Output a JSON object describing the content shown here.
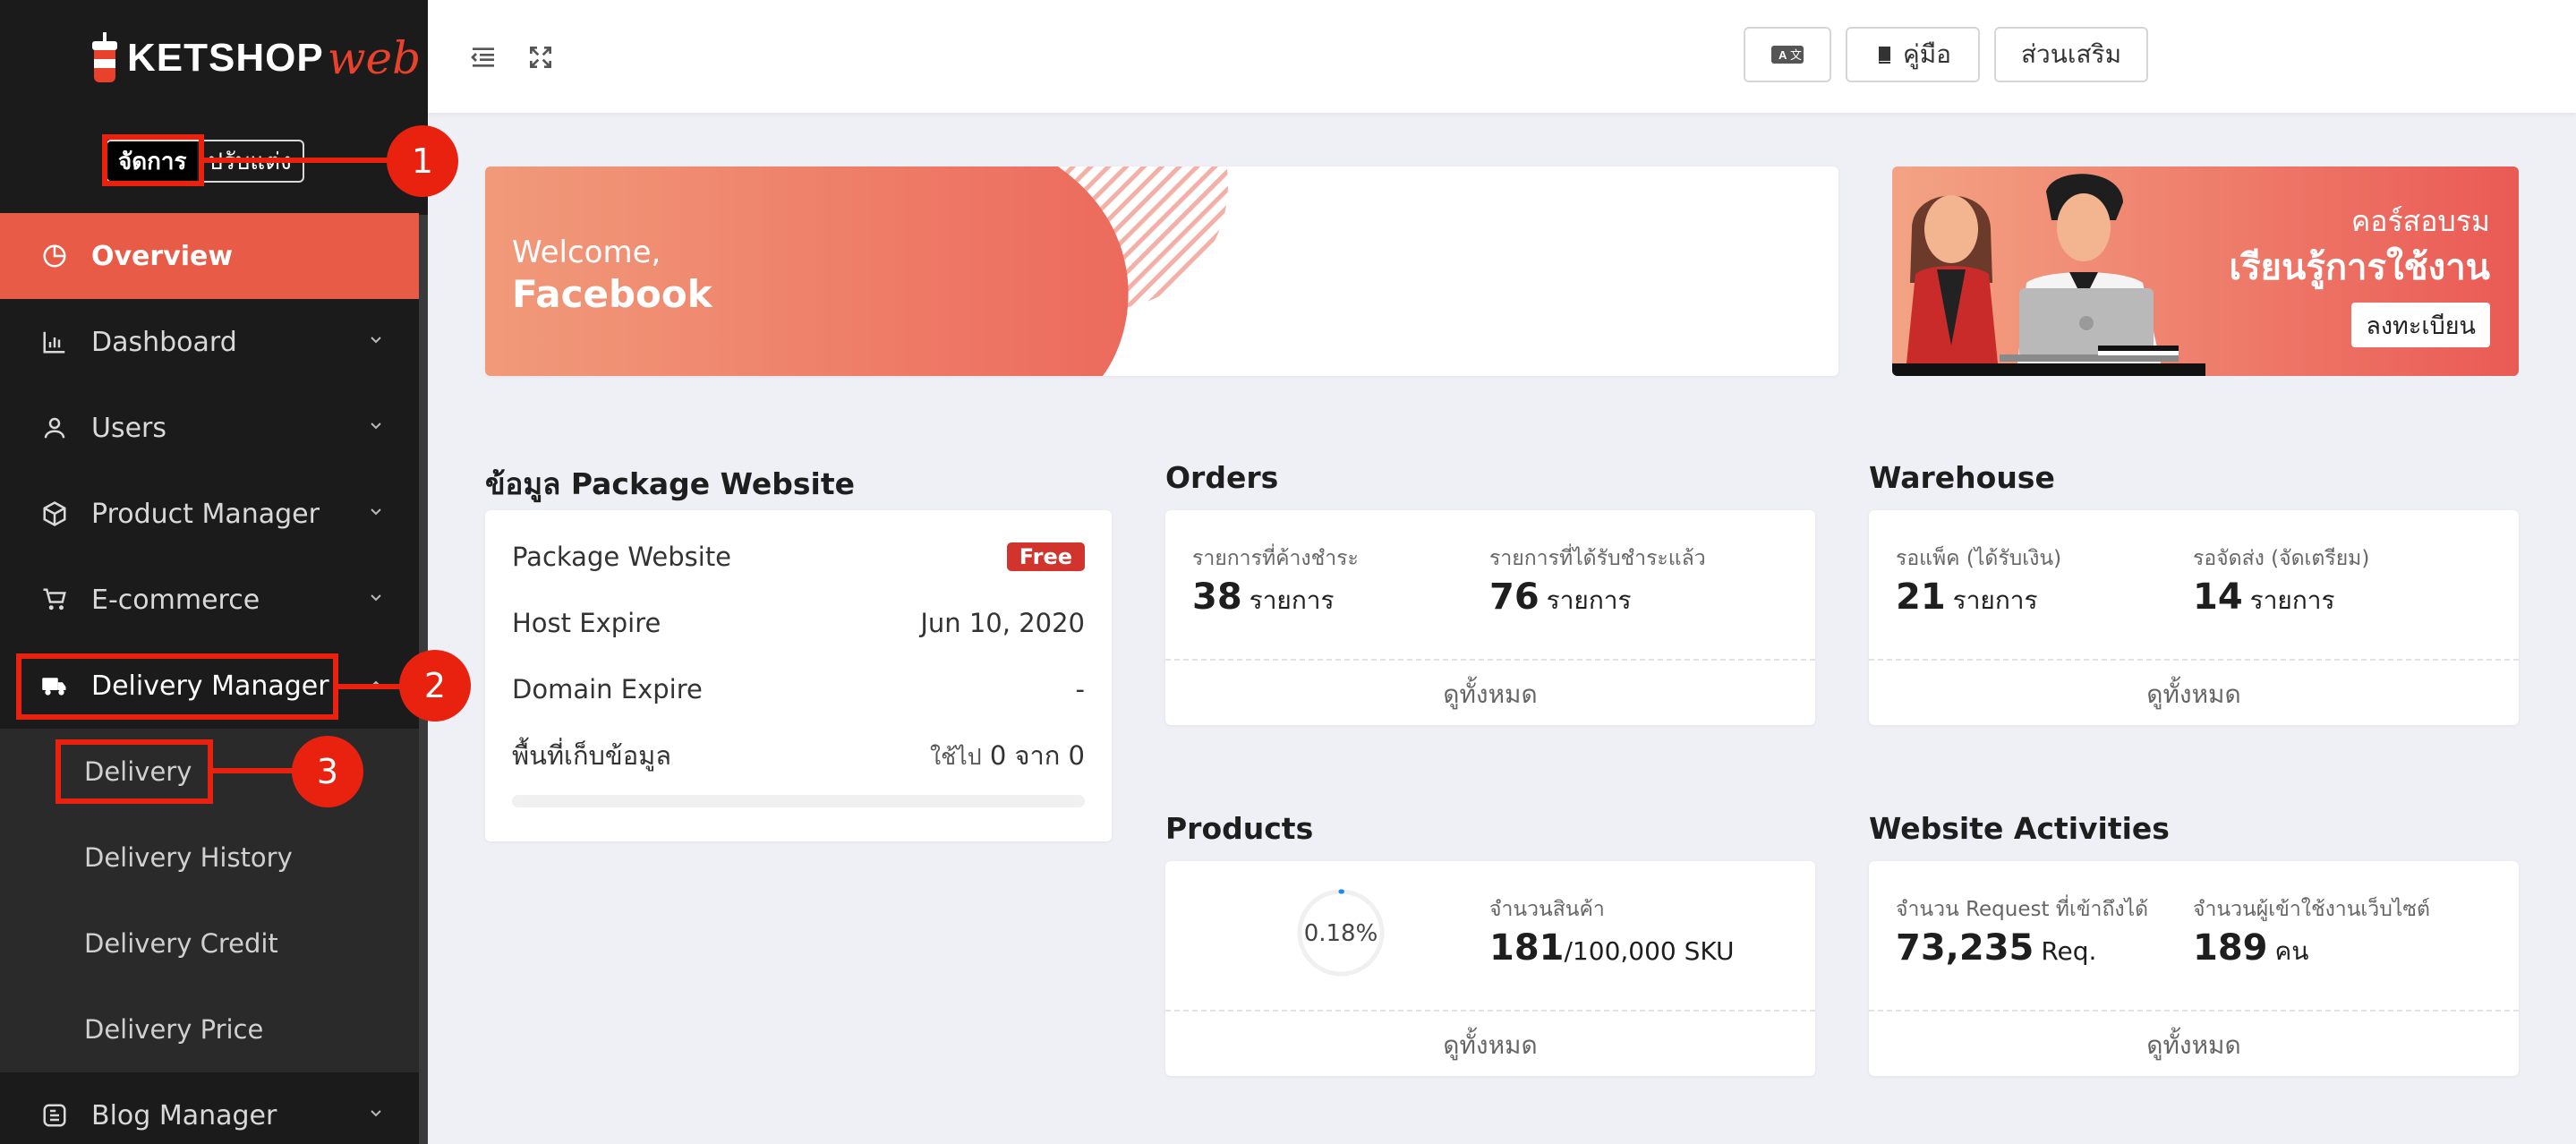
{
  "brand": {
    "text": "KETSHOP",
    "suffix": "web",
    "accent": "#e8412c"
  },
  "mode_switch": {
    "manage": "จัดการ",
    "customize": "ปรับแต่ง"
  },
  "sidebar": {
    "items": [
      {
        "label": "Overview",
        "icon": "pie-chart-icon",
        "active": true
      },
      {
        "label": "Dashboard",
        "icon": "bar-chart-icon"
      },
      {
        "label": "Users",
        "icon": "user-icon"
      },
      {
        "label": "Product Manager",
        "icon": "box-icon"
      },
      {
        "label": "E-commerce",
        "icon": "cart-icon"
      },
      {
        "label": "Delivery Manager",
        "icon": "truck-icon",
        "open": true
      },
      {
        "label": "Blog Manager",
        "icon": "blog-icon"
      }
    ],
    "delivery_sub": [
      "Delivery",
      "Delivery History",
      "Delivery Credit",
      "Delivery Price"
    ]
  },
  "topbar": {
    "manual_label": "คู่มือ",
    "addons_label": "ส่วนเสริม",
    "translate_icon": "translate-icon"
  },
  "welcome": {
    "greeting": "Welcome,",
    "name": "Facebook"
  },
  "course_banner": {
    "line1": "คอร์สอบรม",
    "line2": "เรียนรู้การใช้งาน",
    "button": "ลงทะเบียน"
  },
  "package": {
    "title": "ข้อมูล Package Website",
    "rows": [
      {
        "label": "Package Website",
        "value": "Free"
      },
      {
        "label": "Host Expire",
        "value": "Jun 10, 2020"
      },
      {
        "label": "Domain Expire",
        "value": "-"
      }
    ],
    "storage": {
      "label": "พื้นที่เก็บข้อมูล",
      "used_prefix": "ใช้ไป",
      "used": "0",
      "of": "จาก",
      "total": "0",
      "fraction": 0
    }
  },
  "orders": {
    "title": "Orders",
    "pending_label": "รายการที่ค้างชำระ",
    "pending_value": "38",
    "pending_unit": "รายการ",
    "paid_label": "รายการที่ได้รับชำระแล้ว",
    "paid_value": "76",
    "paid_unit": "รายการ",
    "link": "ดูทั้งหมด"
  },
  "warehouse": {
    "title": "Warehouse",
    "pack_label": "รอแพ็ค (ได้รับเงิน)",
    "pack_value": "21",
    "pack_unit": "รายการ",
    "ship_label": "รอจัดส่ง (จัดเตรียม)",
    "ship_value": "14",
    "ship_unit": "รายการ",
    "link": "ดูทั้งหมด"
  },
  "products": {
    "title": "Products",
    "percent_text": "0.18%",
    "percent": 0.18,
    "count_label": "จำนวนสินค้า",
    "count_value": "181",
    "count_limit": "/100,000 SKU",
    "link": "ดูทั้งหมด"
  },
  "activities": {
    "title": "Website Activities",
    "req_label": "จำนวน Request ที่เข้าถึงได้",
    "req_value": "73,235",
    "req_unit": "Req.",
    "users_label": "จำนวนผู้เข้าใช้งานเว็บไซต์",
    "users_value": "189",
    "users_unit": "คน",
    "link": "ดูทั้งหมด"
  },
  "annotations": [
    "1",
    "2",
    "3"
  ]
}
